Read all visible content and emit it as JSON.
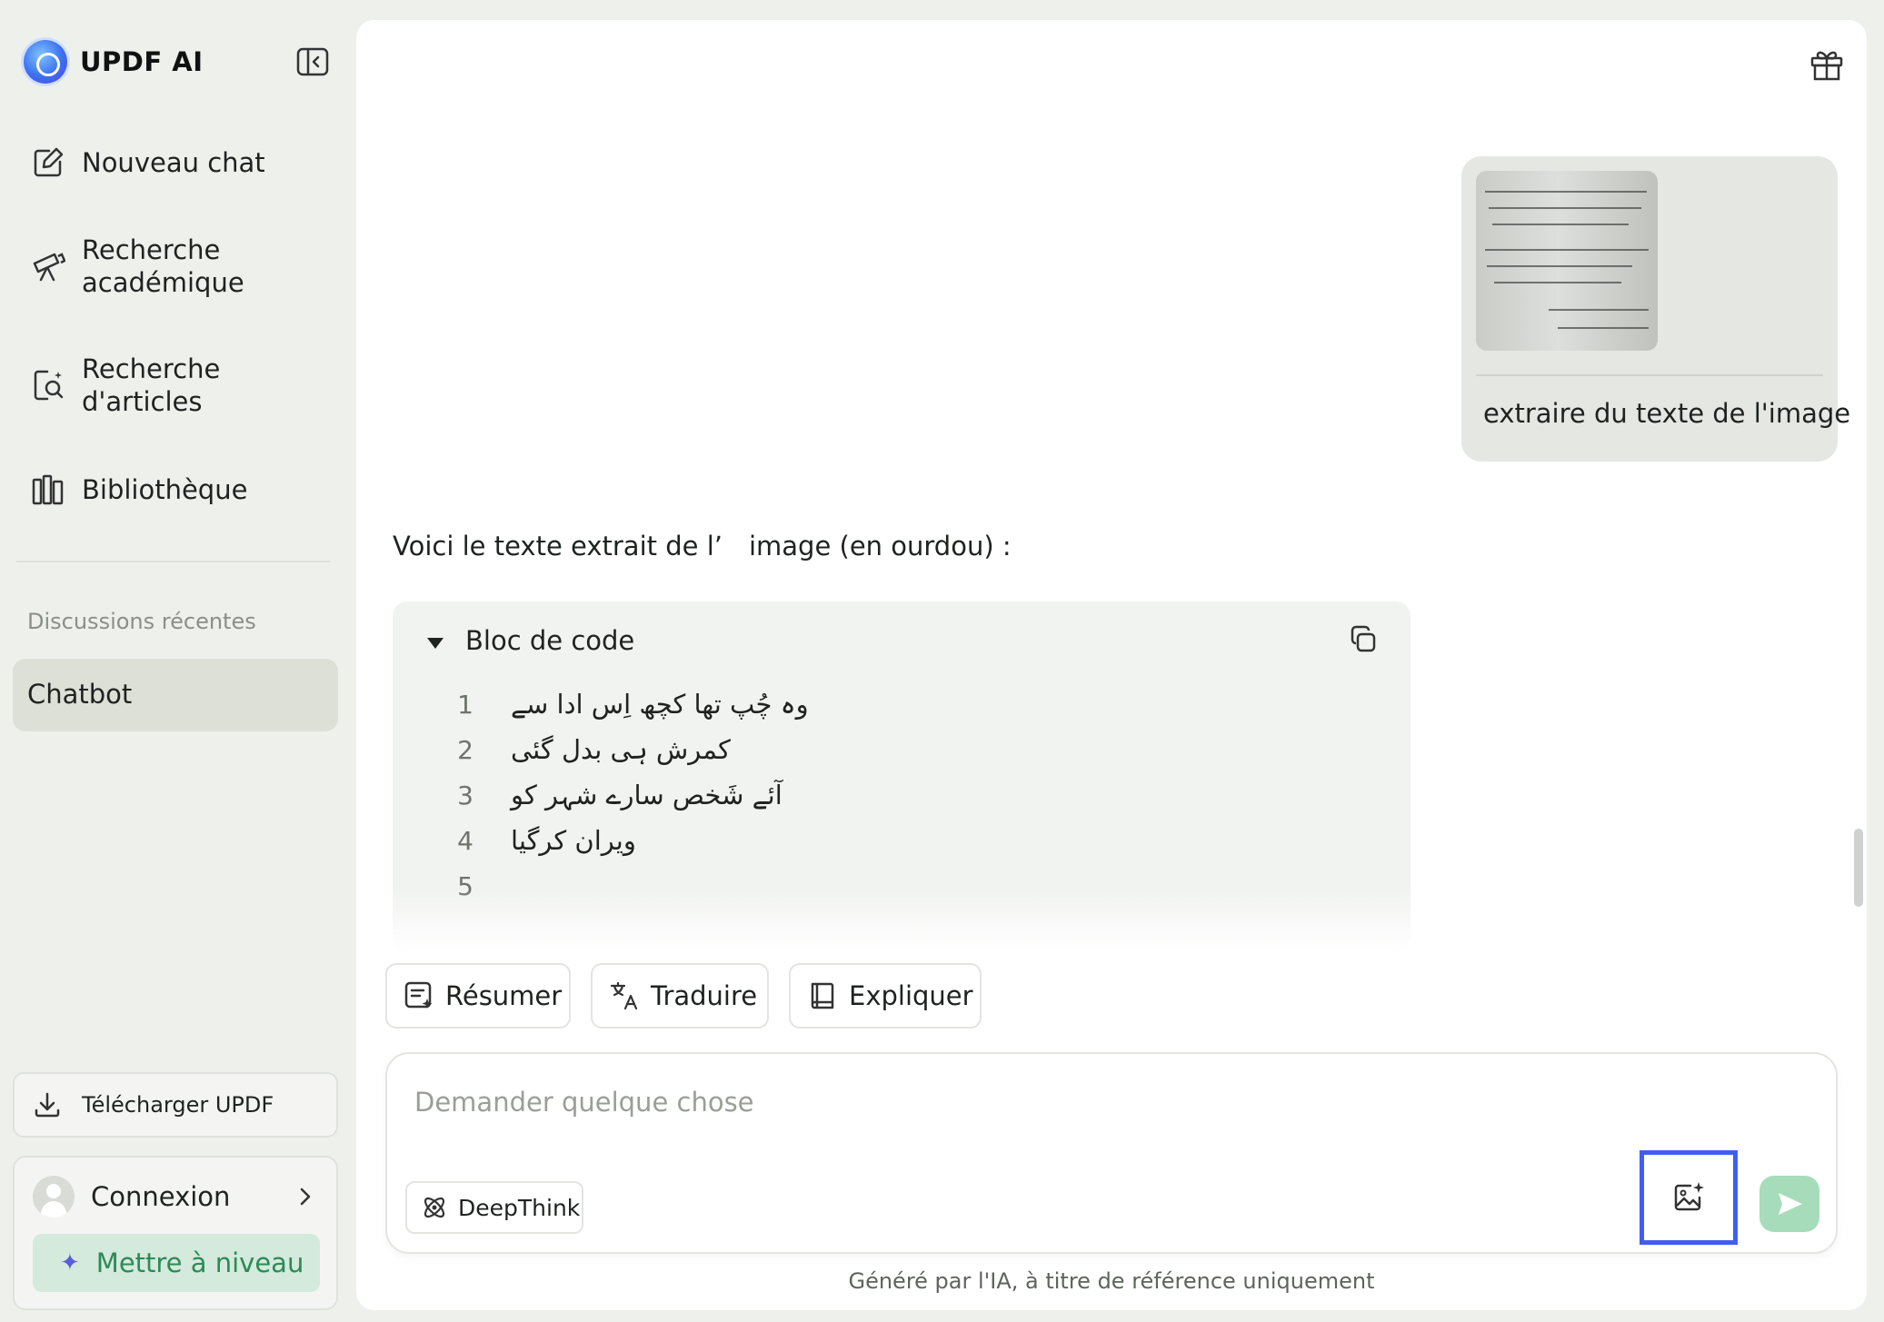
{
  "sidebar": {
    "brand": "UPDF AI",
    "nav": [
      {
        "label": "Nouveau chat",
        "icon": "new-chat-icon"
      },
      {
        "label": "Recherche académique",
        "icon": "telescope-icon"
      },
      {
        "label": "Recherche d'articles",
        "icon": "document-search-icon"
      },
      {
        "label": "Bibliothèque",
        "icon": "library-icon"
      }
    ],
    "recent_title": "Discussions récentes",
    "recent_items": [
      "Chatbot"
    ],
    "download_label": "Télécharger UPDF",
    "login_label": "Connexion",
    "upgrade_label": "Mettre à niveau"
  },
  "chat": {
    "user_message": "extraire du texte de l'image",
    "ai_intro": "Voici le texte extrait de l’ image (en ourdou) :",
    "code_block": {
      "title": "Bloc de code",
      "lines": [
        {
          "n": "1",
          "text": "وہ چُپ تھا کچھ اِس ادا سے"
        },
        {
          "n": "2",
          "text": "کمرش ہی بدل گئی"
        },
        {
          "n": "3",
          "text": "آئے شَخص سارے شہر کو"
        },
        {
          "n": "4",
          "text": "ویران کرگیا"
        },
        {
          "n": "5",
          "text": ""
        }
      ]
    }
  },
  "quick_actions": [
    {
      "label": "Résumer",
      "icon": "summarize-icon"
    },
    {
      "label": "Traduire",
      "icon": "translate-icon"
    },
    {
      "label": "Expliquer",
      "icon": "book-icon"
    }
  ],
  "composer": {
    "placeholder": "Demander quelque chose",
    "value": "",
    "deepthink_label": "DeepThink"
  },
  "disclaimer": "Généré par l'IA, à titre de référence uniquement",
  "colors": {
    "accent_green": "#2d8a55",
    "upgrade_bg": "#d3eadc",
    "send_bg": "#a7dcbb",
    "highlight_box": "#3f5ef0",
    "sidebar_bg": "#eef0ec"
  }
}
